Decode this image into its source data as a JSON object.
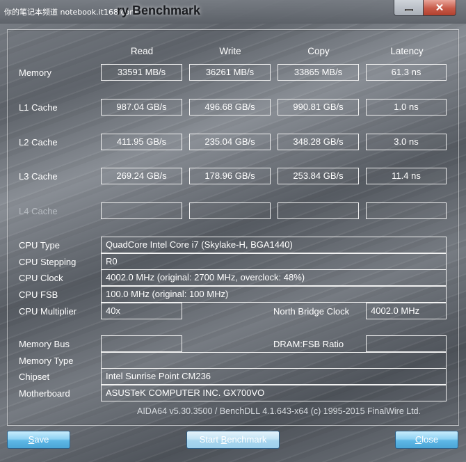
{
  "titlebar": {
    "watermark": "你的笔记本频道 notebook.it168.com",
    "title": "ry Benchmark"
  },
  "columns": [
    "Read",
    "Write",
    "Copy",
    "Latency"
  ],
  "rows": [
    {
      "label": "Memory",
      "values": [
        "33591 MB/s",
        "36261 MB/s",
        "33865 MB/s",
        "61.3 ns"
      ]
    },
    {
      "label": "L1 Cache",
      "values": [
        "987.04 GB/s",
        "496.68 GB/s",
        "990.81 GB/s",
        "1.0 ns"
      ]
    },
    {
      "label": "L2 Cache",
      "values": [
        "411.95 GB/s",
        "235.04 GB/s",
        "348.28 GB/s",
        "3.0 ns"
      ]
    },
    {
      "label": "L3 Cache",
      "values": [
        "269.24 GB/s",
        "178.96 GB/s",
        "253.84 GB/s",
        "11.4 ns"
      ]
    },
    {
      "label": "L4 Cache",
      "values": [
        "",
        "",
        "",
        ""
      ]
    }
  ],
  "info": {
    "cpu_type_label": "CPU Type",
    "cpu_type": "QuadCore Intel Core i7  (Skylake-H, BGA1440)",
    "cpu_stepping_label": "CPU Stepping",
    "cpu_stepping": "R0",
    "cpu_clock_label": "CPU Clock",
    "cpu_clock": "4002.0 MHz  (original: 2700 MHz, overclock: 48%)",
    "cpu_fsb_label": "CPU FSB",
    "cpu_fsb": "100.0 MHz  (original: 100 MHz)",
    "cpu_multiplier_label": "CPU Multiplier",
    "cpu_multiplier": "40x",
    "north_bridge_label": "North Bridge Clock",
    "north_bridge": "4002.0 MHz",
    "memory_bus_label": "Memory Bus",
    "memory_bus": "",
    "dram_fsb_label": "DRAM:FSB Ratio",
    "dram_fsb": "",
    "memory_type_label": "Memory Type",
    "memory_type": "",
    "chipset_label": "Chipset",
    "chipset": "Intel Sunrise Point CM236",
    "motherboard_label": "Motherboard",
    "motherboard": "ASUSTeK COMPUTER INC. GX700VO"
  },
  "footer": "AIDA64 v5.30.3500 / BenchDLL 4.1.643-x64  (c) 1995-2015 FinalWire Ltd.",
  "buttons": {
    "save_first": "S",
    "save_rest": "ave",
    "start_pre": "Start ",
    "start_u": "B",
    "start_rest": "enchmark",
    "close_first": "C",
    "close_rest": "lose"
  },
  "window_controls": {
    "minimize_icon": "minimize-icon",
    "close_icon": "close-x-icon",
    "close_glyph": "✕"
  }
}
